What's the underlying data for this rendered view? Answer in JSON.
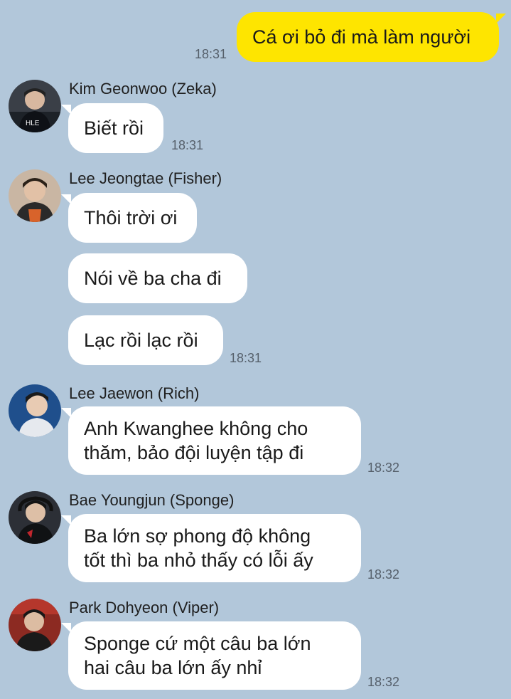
{
  "outgoing": {
    "text": "Cá ơi bỏ đi mà làm người",
    "time": "18:31"
  },
  "groups": [
    {
      "sender": "Kim Geonwoo (Zeka)",
      "messages": [
        "Biết rồi"
      ],
      "time": "18:31"
    },
    {
      "sender": "Lee Jeongtae (Fisher)",
      "messages": [
        "Thôi trời ơi",
        "Nói về ba cha đi",
        "Lạc rồi lạc rồi"
      ],
      "time": "18:31"
    },
    {
      "sender": "Lee Jaewon (Rich)",
      "messages": [
        "Anh Kwanghee không cho\nthăm, bảo đội luyện tập đi"
      ],
      "time": "18:32"
    },
    {
      "sender": "Bae Youngjun (Sponge)",
      "messages": [
        "Ba lớn sợ phong độ không\ntốt thì ba nhỏ thấy có lỗi ấy"
      ],
      "time": "18:32"
    },
    {
      "sender": "Park Dohyeon (Viper)",
      "messages": [
        "Sponge cứ một câu ba lớn\nhai câu ba lớn ấy nhỉ"
      ],
      "time": "18:32"
    }
  ],
  "colors": {
    "background": "#b2c7da",
    "outgoing_bubble": "#fee500",
    "incoming_bubble": "#ffffff"
  }
}
